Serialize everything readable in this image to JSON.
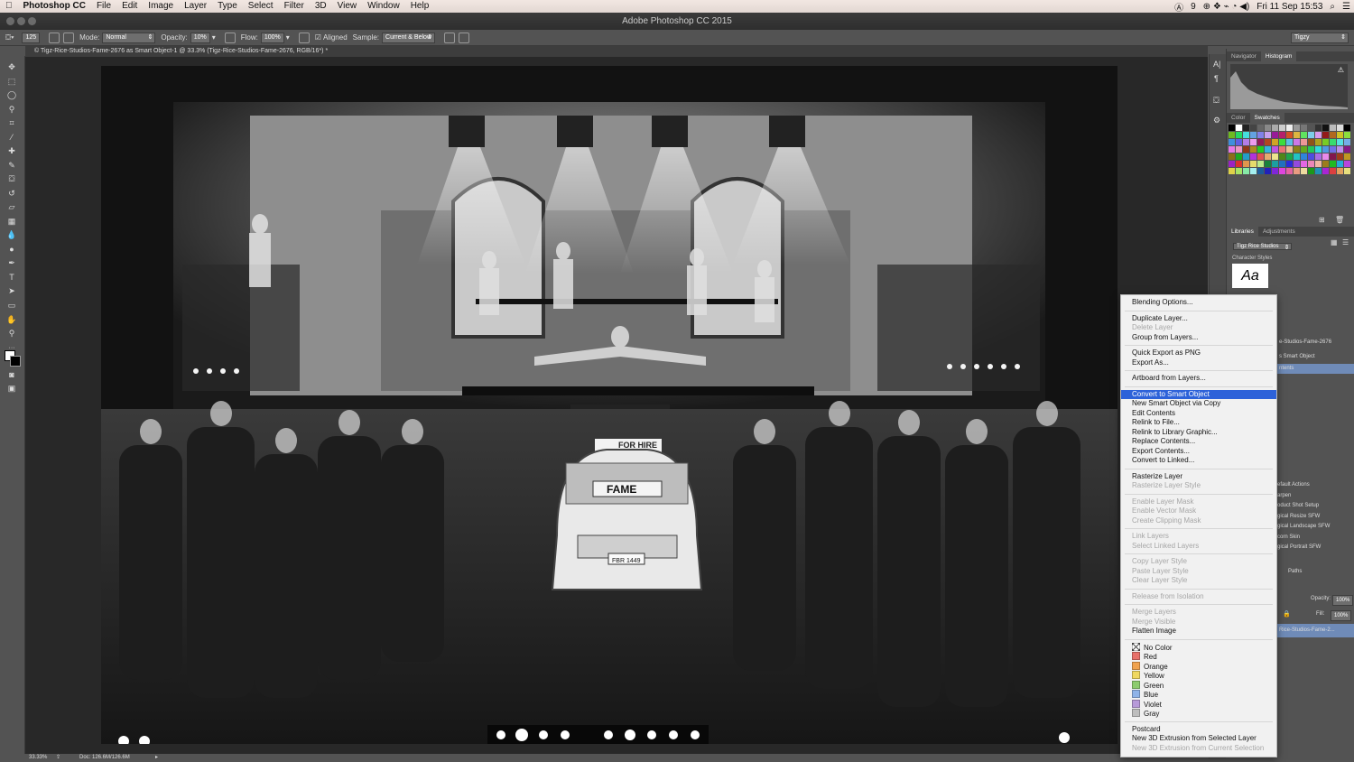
{
  "menubar": {
    "app": "Photoshop CC",
    "items": [
      "File",
      "Edit",
      "Image",
      "Layer",
      "Type",
      "Select",
      "Filter",
      "3D",
      "View",
      "Window",
      "Help"
    ],
    "status_badge": "9",
    "datetime": "Fri 11 Sep  15:53"
  },
  "window": {
    "title": "Adobe Photoshop CC 2015"
  },
  "options_bar": {
    "brush_size": "125",
    "mode_label": "Mode:",
    "mode_value": "Normal",
    "opacity_label": "Opacity:",
    "opacity_value": "10%",
    "flow_label": "Flow:",
    "flow_value": "100%",
    "aligned_label": "Aligned",
    "sample_label": "Sample:",
    "sample_value": "Current & Below",
    "workspace": "Tigzy"
  },
  "document": {
    "tab_title": "© Tigz-Rice-Studios-Fame-2676 as Smart Object-1 @ 33.3% (Tigz-Rice-Studios-Fame-2676, RGB/16*) *",
    "sign_for_hire": "FOR HIRE",
    "sign_fame": "FAME",
    "plate": "FBR 1449"
  },
  "status": {
    "zoom": "33.33%",
    "doc": "Doc: 126.6M/126.6M"
  },
  "panels": {
    "navigator_tab": "Navigator",
    "histogram_tab": "Histogram",
    "color_tab": "Color",
    "swatches_tab": "Swatches",
    "libraries_tab": "Libraries",
    "adjustments_tab": "Adjustments",
    "library_name": "Tigz Rice Studios",
    "character_styles": "Character Styles",
    "aa_sample": "Aa",
    "layer_partial_1": "e-Studios-Fame-2676",
    "layer_partial_2": "s Smart Object",
    "layer_partial_3": "ntents",
    "actions": [
      "efault Actions",
      "arpen",
      "oduct Shot Setup",
      "gical Resize SFW",
      "gical Landscape SFW",
      "corn Skin",
      "gical Portrait SFW"
    ],
    "paths_tab": "Paths",
    "layers_opacity_label": "Opacity:",
    "layers_opacity": "100%",
    "fill_label": "Fill:",
    "fill": "100%",
    "layer_name": "Rice-Studios-Fame-2..."
  },
  "context_menu": [
    {
      "label": "Blending Options...",
      "state": "normal"
    },
    {
      "sep": true
    },
    {
      "label": "Duplicate Layer...",
      "state": "normal"
    },
    {
      "label": "Delete Layer",
      "state": "disabled"
    },
    {
      "label": "Group from Layers...",
      "state": "normal"
    },
    {
      "sep": true
    },
    {
      "label": "Quick Export as PNG",
      "state": "normal"
    },
    {
      "label": "Export As...",
      "state": "normal"
    },
    {
      "sep": true
    },
    {
      "label": "Artboard from Layers...",
      "state": "normal"
    },
    {
      "sep": true
    },
    {
      "label": "Convert to Smart Object",
      "state": "highlighted"
    },
    {
      "label": "New Smart Object via Copy",
      "state": "normal"
    },
    {
      "label": "Edit Contents",
      "state": "normal"
    },
    {
      "label": "Relink to File...",
      "state": "normal"
    },
    {
      "label": "Relink to Library Graphic...",
      "state": "normal"
    },
    {
      "label": "Replace Contents...",
      "state": "normal"
    },
    {
      "label": "Export Contents...",
      "state": "normal"
    },
    {
      "label": "Convert to Linked...",
      "state": "normal"
    },
    {
      "sep": true
    },
    {
      "label": "Rasterize Layer",
      "state": "normal"
    },
    {
      "label": "Rasterize Layer Style",
      "state": "disabled"
    },
    {
      "sep": true
    },
    {
      "label": "Enable Layer Mask",
      "state": "disabled"
    },
    {
      "label": "Enable Vector Mask",
      "state": "disabled"
    },
    {
      "label": "Create Clipping Mask",
      "state": "disabled"
    },
    {
      "sep": true
    },
    {
      "label": "Link Layers",
      "state": "disabled"
    },
    {
      "label": "Select Linked Layers",
      "state": "disabled"
    },
    {
      "sep": true
    },
    {
      "label": "Copy Layer Style",
      "state": "disabled"
    },
    {
      "label": "Paste Layer Style",
      "state": "disabled"
    },
    {
      "label": "Clear Layer Style",
      "state": "disabled"
    },
    {
      "sep": true
    },
    {
      "label": "Release from Isolation",
      "state": "disabled"
    },
    {
      "sep": true
    },
    {
      "label": "Merge Layers",
      "state": "disabled"
    },
    {
      "label": "Merge Visible",
      "state": "disabled"
    },
    {
      "label": "Flatten Image",
      "state": "normal"
    },
    {
      "sep": true
    },
    {
      "label": "No Color",
      "state": "normal",
      "swatch": "none"
    },
    {
      "label": "Red",
      "state": "normal",
      "swatch": "#e8716a"
    },
    {
      "label": "Orange",
      "state": "normal",
      "swatch": "#f0a24e"
    },
    {
      "label": "Yellow",
      "state": "normal",
      "swatch": "#efd860"
    },
    {
      "label": "Green",
      "state": "normal",
      "swatch": "#8ccc6e"
    },
    {
      "label": "Blue",
      "state": "normal",
      "swatch": "#8fb3e8"
    },
    {
      "label": "Violet",
      "state": "normal",
      "swatch": "#b79ad9"
    },
    {
      "label": "Gray",
      "state": "normal",
      "swatch": "#bdbdbd"
    },
    {
      "sep": true
    },
    {
      "label": "Postcard",
      "state": "normal"
    },
    {
      "label": "New 3D Extrusion from Selected Layer",
      "state": "normal"
    },
    {
      "label": "New 3D Extrusion from Current Selection",
      "state": "disabled"
    }
  ],
  "colors": {
    "highlight": "#2d62d9",
    "menubar": "#eee3de",
    "panel": "#535353"
  }
}
